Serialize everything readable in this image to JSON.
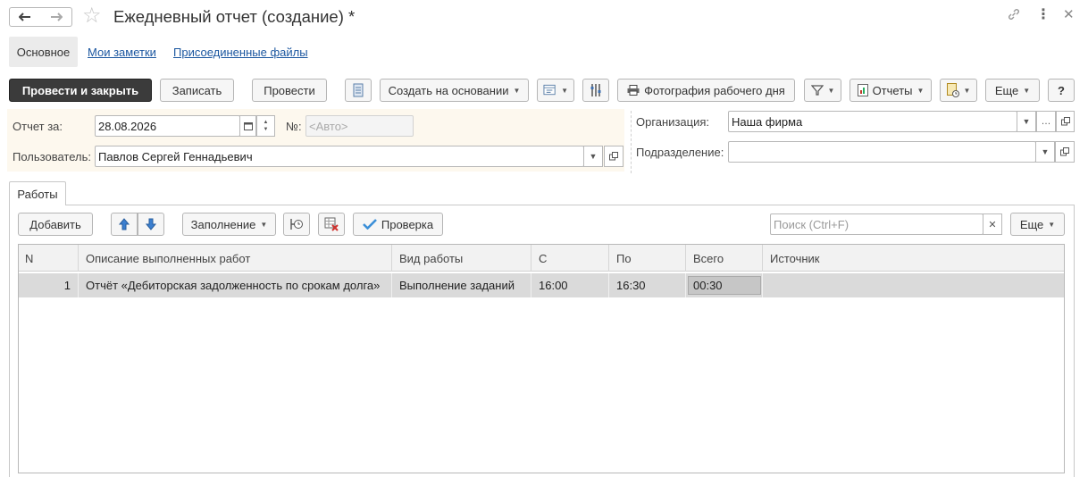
{
  "window": {
    "title": "Ежедневный отчет (создание) *"
  },
  "subtabs": [
    "Основное",
    "Мои заметки",
    "Присоединенные файлы"
  ],
  "toolbar": {
    "post_and_close": "Провести и закрыть",
    "save": "Записать",
    "post": "Провести",
    "create_based_on": "Создать на основании",
    "workday_photo": "Фотография рабочего дня",
    "reports": "Отчеты",
    "more": "Еще",
    "help": "?"
  },
  "form": {
    "report_for_label": "Отчет за:",
    "report_date": "28.08.2026",
    "number_label": "№:",
    "number_placeholder": "<Авто>",
    "user_label": "Пользователь:",
    "user_value": "Павлов Сергей Геннадьевич",
    "org_label": "Организация:",
    "org_value": "Наша фирма",
    "dept_label": "Подразделение:",
    "dept_value": ""
  },
  "works_tab": {
    "tab_label": "Работы",
    "add": "Добавить",
    "fill": "Заполнение",
    "check": "Проверка",
    "search_placeholder": "Поиск (Ctrl+F)",
    "more": "Еще"
  },
  "table": {
    "columns": [
      "N",
      "Описание выполненных работ",
      "Вид работы",
      "С",
      "По",
      "Всего",
      "Источник"
    ],
    "rows": [
      {
        "n": "1",
        "description": "Отчёт «Дебиторская задолженность по срокам долга»",
        "work_type": "Выполнение заданий",
        "from": "16:00",
        "to": "16:30",
        "total": "00:30",
        "source": ""
      }
    ]
  }
}
